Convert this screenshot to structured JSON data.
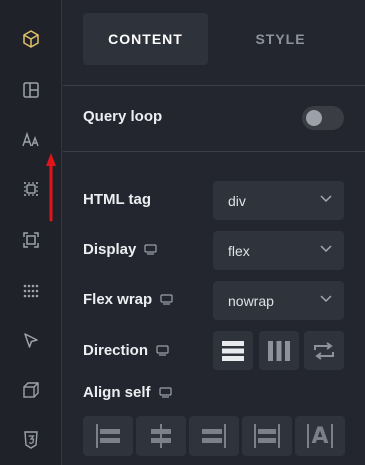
{
  "sidebar": {
    "icons": [
      "cube-icon",
      "layout-icon",
      "typography-icon",
      "spacing-icon",
      "frame-icon",
      "grid-dots-icon",
      "cursor-icon",
      "transform-3d-icon",
      "css3-icon"
    ]
  },
  "tabs": {
    "content": "CONTENT",
    "style": "STYLE"
  },
  "query_loop": {
    "label": "Query loop",
    "enabled": false
  },
  "html_tag": {
    "label": "HTML tag",
    "value": "div"
  },
  "display": {
    "label": "Display",
    "value": "flex"
  },
  "flex_wrap": {
    "label": "Flex wrap",
    "value": "nowrap"
  },
  "direction": {
    "label": "Direction"
  },
  "align_self": {
    "label": "Align self",
    "last_button": "A"
  },
  "colors": {
    "accent": "#e2c26a",
    "arrow": "#e0141b"
  }
}
